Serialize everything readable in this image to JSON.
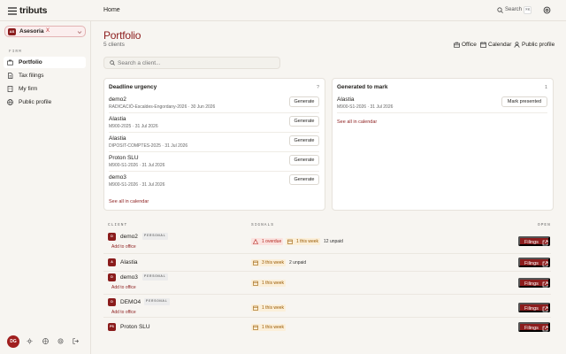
{
  "app": {
    "brand": "tributs",
    "breadcrumb": "Home"
  },
  "topbar": {
    "search_label": "Search",
    "search_kbd": "⌘K"
  },
  "colors": {
    "accent": "#8c1d1d",
    "urgent_bg": "#fbe3e0",
    "warning_bg": "#fbefd9"
  },
  "sidebar": {
    "org": {
      "avatar": "AS",
      "name": "Asesoria",
      "mark": "X"
    },
    "section": "FIRM",
    "items": [
      {
        "label": "Portfolio",
        "icon": "briefcase-icon",
        "active": true
      },
      {
        "label": "Tax filings",
        "icon": "document-icon",
        "active": false
      },
      {
        "label": "My firm",
        "icon": "building-icon",
        "active": false
      },
      {
        "label": "Public profile",
        "icon": "globe-icon",
        "active": false
      }
    ],
    "user_initials": "DG"
  },
  "page": {
    "title": "Portfolio",
    "subtitle": "5 clients"
  },
  "quick_links": [
    {
      "label": "Office",
      "icon": "office-icon"
    },
    {
      "label": "Calendar",
      "icon": "calendar-icon"
    },
    {
      "label": "Public profile",
      "icon": "person-icon"
    }
  ],
  "search": {
    "placeholder": "Search a client..."
  },
  "urgency": {
    "title": "Deadline urgency",
    "count": "?",
    "rows": [
      {
        "name": "demo2",
        "meta": "RADICACIÓ-Escaldes-Engordany-2026 · 30 Jun 2026",
        "action": "Generate"
      },
      {
        "name": "Alastia",
        "meta": "M900-2025 · 31 Jul 2026",
        "action": "Generate"
      },
      {
        "name": "Alastia",
        "meta": "DIPOSIT-COMPTES-2025 · 31 Jul 2026",
        "action": "Generate"
      },
      {
        "name": "Proton SLU",
        "meta": "M900-S1-2026 · 31 Jul 2026",
        "action": "Generate"
      },
      {
        "name": "demo3",
        "meta": "M900-S1-2026 · 31 Jul 2026",
        "action": "Generate"
      }
    ],
    "see_all": "See all in calendar"
  },
  "generated": {
    "title": "Generated to mark",
    "count": "1",
    "rows": [
      {
        "name": "Alastia",
        "meta": "M900-S1-2026 · 31 Jul 2026",
        "action": "Mark presented"
      }
    ],
    "see_all": "See all in calendar"
  },
  "table": {
    "headers": {
      "client": "CLIENT",
      "signals": "SIGNALS",
      "open": "OPEN"
    },
    "rows": [
      {
        "avatar": "D",
        "name": "demo2",
        "tag": "PERSONAL",
        "add_office": "Add to office",
        "overdue": "1 overdue",
        "week": "1 this week",
        "unpaid": "12 unpaid",
        "action": "Filings"
      },
      {
        "avatar": "A",
        "name": "Alastia",
        "tag": "",
        "add_office": "",
        "overdue": "",
        "week": "3 this week",
        "unpaid": "2 unpaid",
        "action": "Filings"
      },
      {
        "avatar": "D",
        "name": "demo3",
        "tag": "PERSONAL",
        "add_office": "Add to office",
        "overdue": "",
        "week": "1 this week",
        "unpaid": "",
        "action": "Filings"
      },
      {
        "avatar": "D",
        "name": "DEMO4",
        "tag": "PERSONAL",
        "add_office": "Add to office",
        "overdue": "",
        "week": "1 this week",
        "unpaid": "",
        "action": "Filings"
      },
      {
        "avatar": "PS",
        "name": "Proton SLU",
        "tag": "",
        "add_office": "",
        "overdue": "",
        "week": "1 this week",
        "unpaid": "",
        "action": "Filings"
      }
    ]
  }
}
